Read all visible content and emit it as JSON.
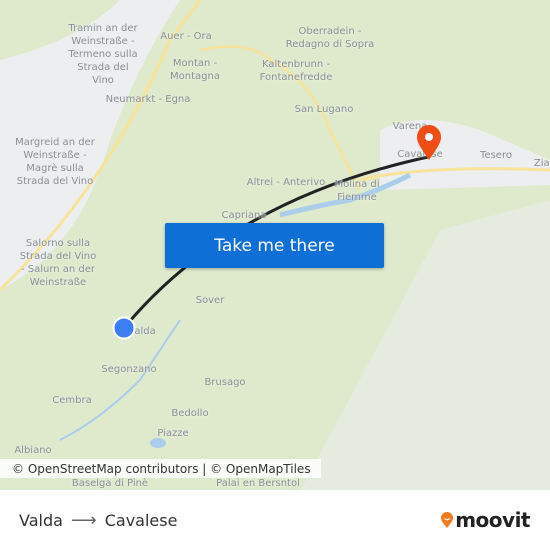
{
  "map": {
    "labels": [
      "Tramin an der Weinstraße - Termeno sulla Strada del Vino",
      "Auer - Ora",
      "Montan - Montagna",
      "Oberradein - Redagno di Sopra",
      "Kaltenbrunn - Fontanefredde",
      "Neumarkt - Egna",
      "San Lugano",
      "Margreid an der Weinstraße - Magrè sulla Strada del Vino",
      "Varena",
      "Cavalese",
      "Tesero",
      "Ziano",
      "Altrei - Anterivo",
      "Molina di Fiemme",
      "Capriana",
      "Salorno sulla Strada del Vino - Salurn an der Weinstraße",
      "Sover",
      "Valda",
      "Segonzano",
      "Brusago",
      "Cembra",
      "Bedollo",
      "Piazze",
      "Albiano",
      "Baselga di Pinè",
      "Palai en Bersntol"
    ],
    "origin": "Valda",
    "destination": "Cavalese",
    "colors": {
      "route": "#222222",
      "pin": "#f04d16",
      "origin": "#3d7ff2",
      "button": "#0e6fd6"
    }
  },
  "cta": {
    "label": "Take me there"
  },
  "attribution": "© OpenStreetMap contributors | © OpenMapTiles",
  "footer": {
    "from": "Valda",
    "to": "Cavalese",
    "logo": "moovit"
  }
}
